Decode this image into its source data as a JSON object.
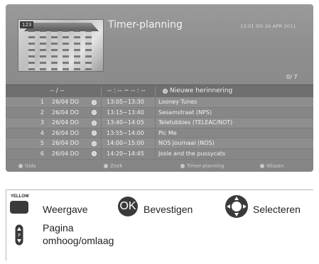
{
  "screen": {
    "title": "Timer-planning",
    "datetime": "13:01  DO 26 APR 2011",
    "channel_badge": "123",
    "counter": "0/ 7"
  },
  "list_header": {
    "date": "-- / --",
    "time": "-- : -- ~ -- : --",
    "new_reminder": "Nieuwe herinnering"
  },
  "rows": [
    {
      "num": "1",
      "date": "26/04 DO",
      "time": "13:05~13:30",
      "program": "Looney Tunes"
    },
    {
      "num": "2",
      "date": "26/04 DO",
      "time": "13:15~13:40",
      "program": "Sesamstraat (NPS)"
    },
    {
      "num": "3",
      "date": "26/04 DO",
      "time": "13:40~14:05",
      "program": "Teletubbies (TELEAC/NOT)"
    },
    {
      "num": "4",
      "date": "26/04 DO",
      "time": "13:55~14:00",
      "program": "Pic Me"
    },
    {
      "num": "5",
      "date": "26/04 DO",
      "time": "14:00~15:00",
      "program": "NOS Journaal (NOS)"
    },
    {
      "num": "6",
      "date": "26/04 DO",
      "time": "14:20~14:45",
      "program": "Josie and the pussycats"
    }
  ],
  "footer_keys": [
    "Gids",
    "Zoek",
    "Timer-planning",
    "Wissen"
  ],
  "legend": {
    "yellow_key": "YELLOW",
    "weergave": "Weergave",
    "ok": "OK",
    "bevestigen": "Bevestigen",
    "selecteren": "Selecteren",
    "page_key": "P",
    "pagina": "Pagina",
    "omhoog": "omhoog/omlaag"
  }
}
